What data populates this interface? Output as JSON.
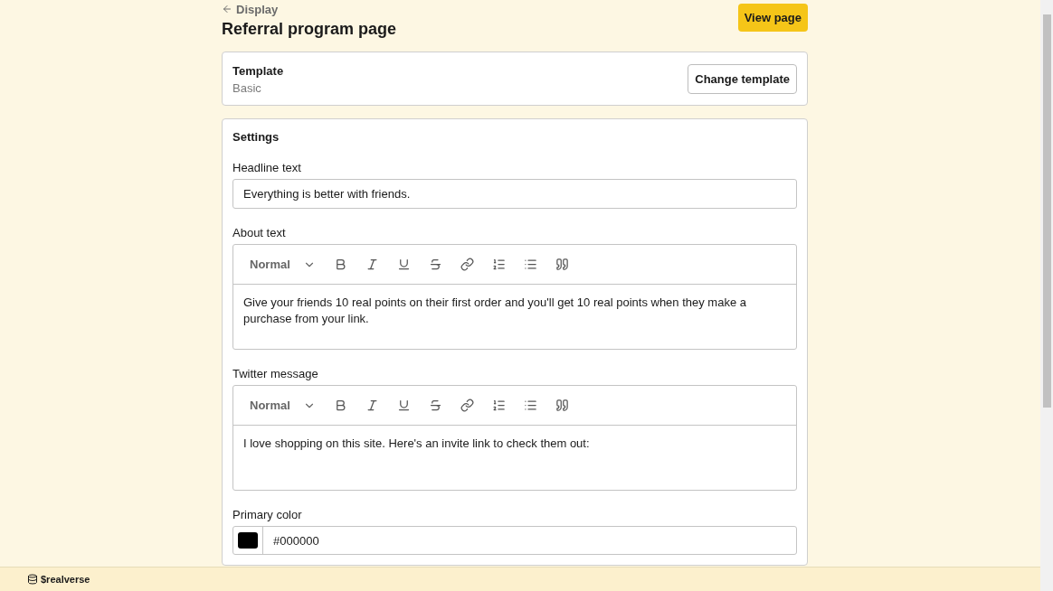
{
  "back_link": "Display",
  "title": "Referral program page",
  "view_button": "View page",
  "template": {
    "label": "Template",
    "value": "Basic",
    "button": "Change template"
  },
  "settings": {
    "title": "Settings",
    "fields": [
      {
        "kind": "text",
        "label": "Headline text",
        "value": "Everything is better with friends."
      },
      {
        "kind": "rich",
        "label": "About text",
        "format": "Normal",
        "value": "Give your friends 10 real points on their first order and you'll get 10 real points when they make a purchase from your link."
      },
      {
        "kind": "rich",
        "label": "Twitter message",
        "format": "Normal",
        "value": "I love shopping on this site. Here's an invite link to check them out:"
      },
      {
        "kind": "color",
        "label": "Primary color",
        "value": "#000000",
        "color": "#000000"
      }
    ]
  },
  "footer": {
    "brand": "$realverse"
  }
}
